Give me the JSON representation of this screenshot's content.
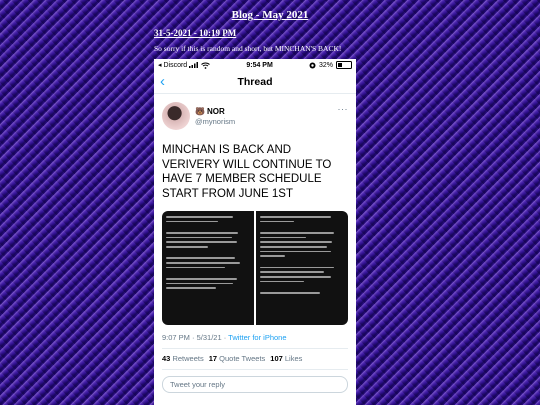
{
  "blog": {
    "title": "Blog - May 2021",
    "post_date": "31-5-2021 - 10:19 PM",
    "post_text": "So sorry if this is random and short, but MINCHAN'S BACK!"
  },
  "phone": {
    "status": {
      "carrier": "◂ Discord",
      "time": "9:54 PM",
      "battery": "32%"
    },
    "nav": {
      "back_icon": "chevron-left",
      "title": "Thread"
    },
    "tweet": {
      "display_name": "NOR",
      "handle": "@mynorism",
      "more_icon": "···",
      "text": "MINCHAN IS BACK AND VERIVERY WILL CONTINUE TO HAVE 7 MEMBER SCHEDULE START FROM JUNE 1ST",
      "time": "9:07 PM · 5/31/21 · ",
      "source": "Twitter for iPhone",
      "retweets_count": "43",
      "retweets_label": "Retweets",
      "quotes_count": "17",
      "quotes_label": "Quote Tweets",
      "likes_count": "107",
      "likes_label": "Likes",
      "reply_placeholder": "Tweet your reply"
    }
  }
}
